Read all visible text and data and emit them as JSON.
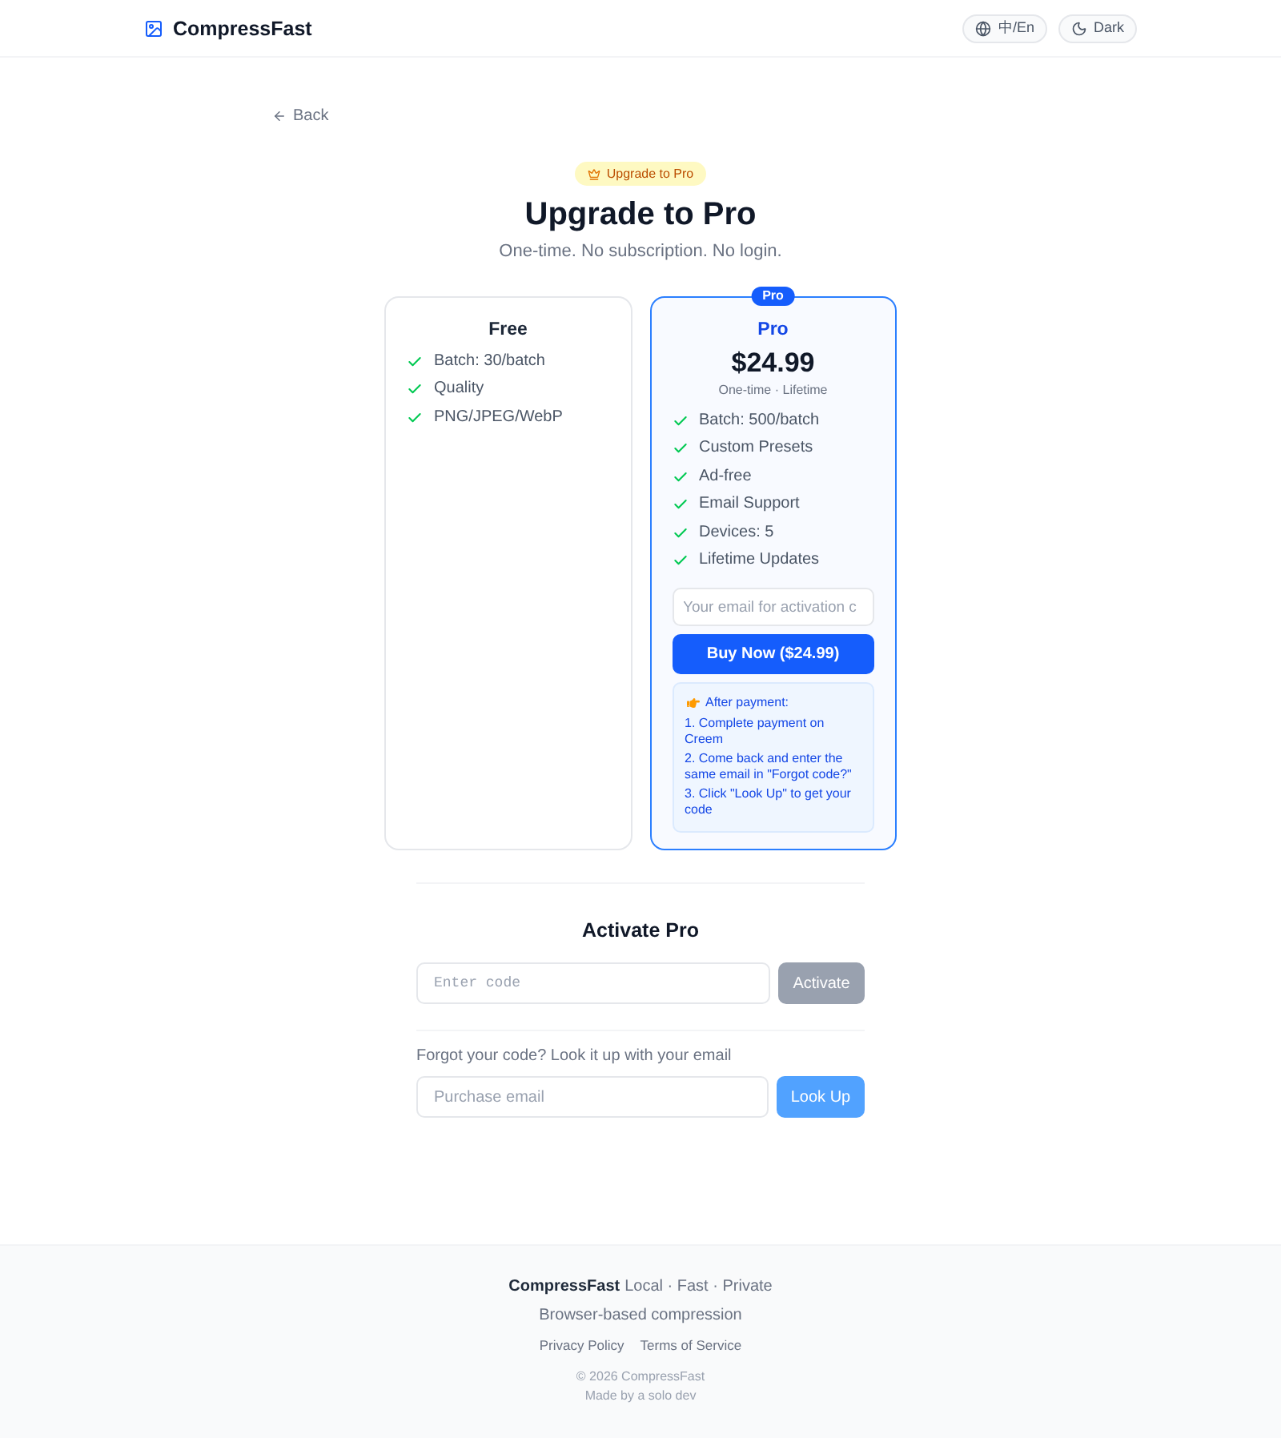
{
  "header": {
    "brand": "CompressFast",
    "buttons": [
      {
        "kind": "language",
        "label": "中/En"
      },
      {
        "kind": "theme",
        "label": "Dark"
      }
    ]
  },
  "back": {
    "label": "Back"
  },
  "hero": {
    "badge": "Upgrade to Pro",
    "title": "Upgrade to Pro",
    "subtitle": "One-time. No subscription. No login."
  },
  "plans": [
    {
      "name": "Free",
      "highlighted": false,
      "features": [
        "Batch: 30/batch",
        "Quality",
        "PNG/JPEG/WebP"
      ]
    },
    {
      "name": "Pro",
      "highlighted": true,
      "ribbon": "Pro",
      "price": "$24.99",
      "price_note": "One-time · Lifetime",
      "features": [
        "Batch: 500/batch",
        "Custom Presets",
        "Ad-free",
        "Email Support",
        "Devices: 5",
        "Lifetime Updates"
      ],
      "email_field": {
        "placeholder": "Your email for activation c"
      },
      "buy_button": {
        "label": "Buy Now ($24.99)",
        "disabled": false
      },
      "info": {
        "heading": "After payment:",
        "steps": [
          "1. Complete payment on Creem",
          "2. Come back and enter the same email in \"Forgot code?\"",
          "3. Click \"Look Up\" to get your code"
        ]
      }
    }
  ],
  "activate": {
    "title": "Activate Pro",
    "code_field": {
      "placeholder": "Enter code"
    },
    "activate_button": {
      "label": "Activate",
      "disabled": true
    },
    "lookup_prompt": "Forgot your code? Look it up with your email",
    "email_field": {
      "placeholder": "Purchase email"
    },
    "lookup_button": {
      "label": "Look Up",
      "disabled": true
    }
  },
  "footer": {
    "brand": "CompressFast",
    "tagline": "Local · Fast · Private",
    "description": "Browser-based compression",
    "links": [
      "Privacy Policy",
      "Terms of Service"
    ],
    "copyright": "© 2026 CompressFast",
    "credit": "Made by a solo dev"
  }
}
